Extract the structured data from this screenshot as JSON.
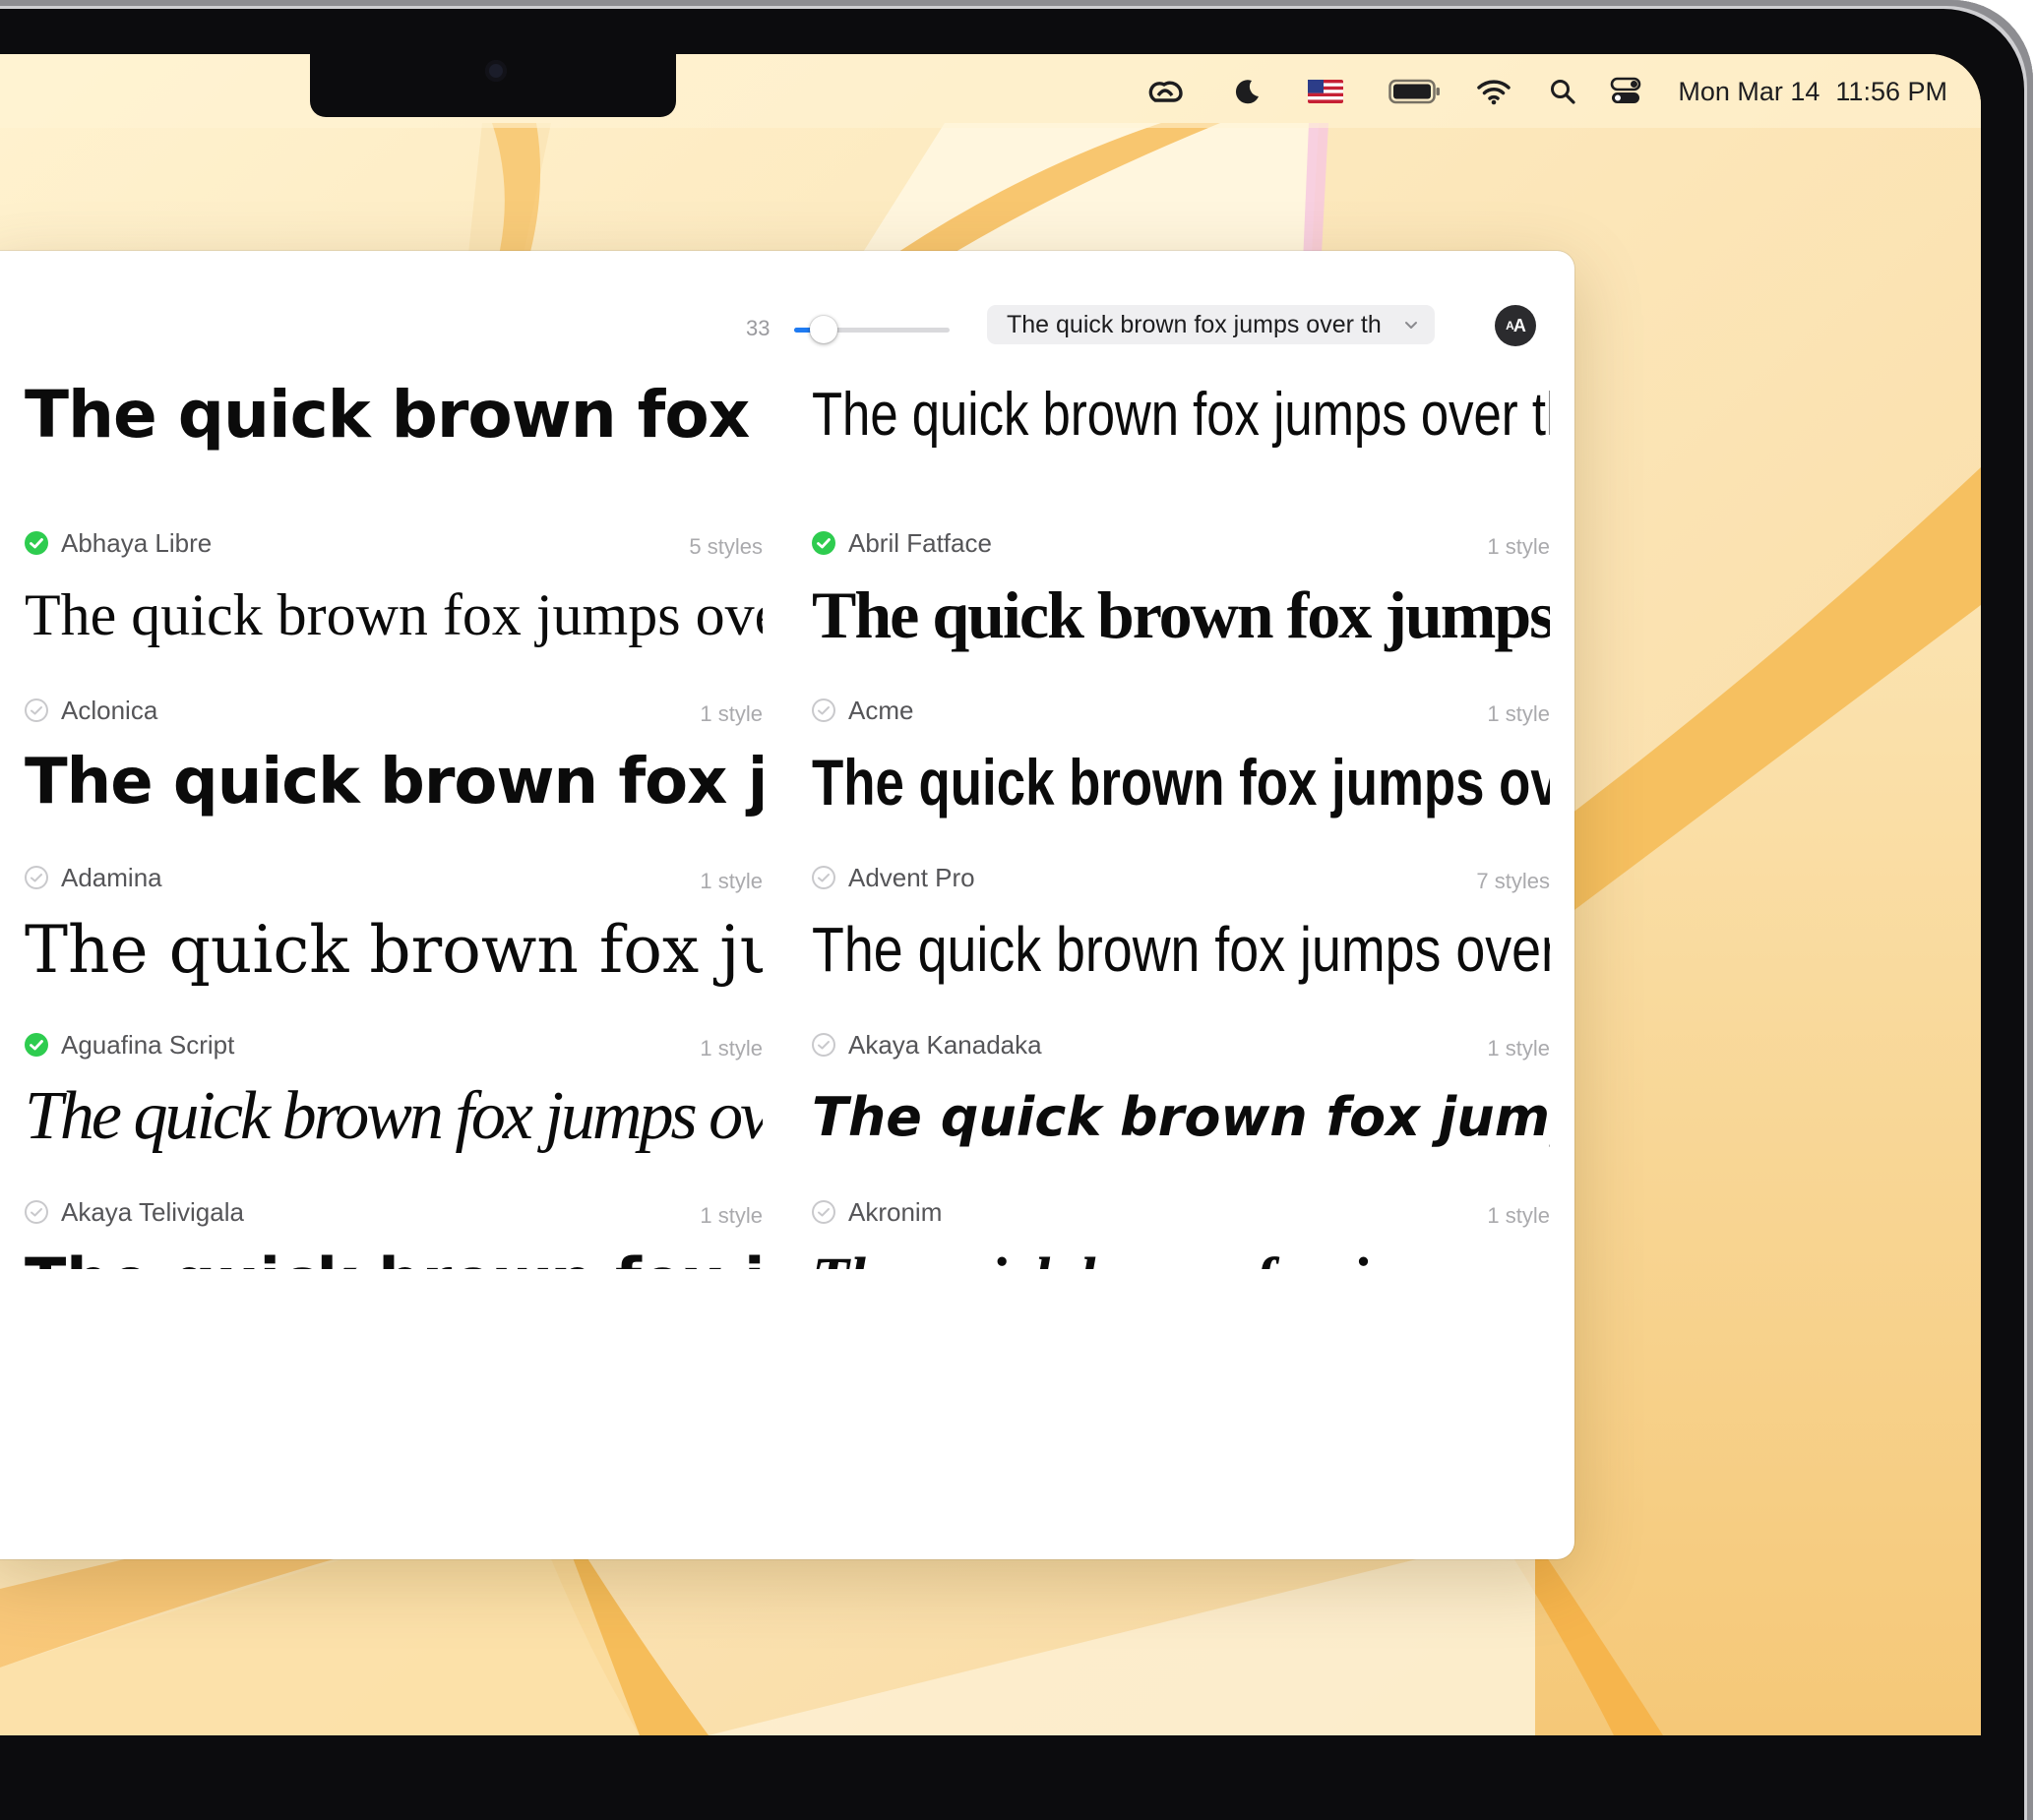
{
  "menubar": {
    "icons": [
      "creative-cloud-icon",
      "moon-icon",
      "us-flag-icon",
      "battery-icon",
      "wifi-icon",
      "search-icon",
      "control-center-icon"
    ],
    "date": "Mon Mar 14",
    "time": "11:56 PM"
  },
  "toolbar": {
    "size_value": "33",
    "size_fraction": 0.12,
    "sample_text": "The quick brown fox jumps over th",
    "aa_label_small": "A",
    "aa_label_big": "A",
    "accent_color": "#1f7bf2"
  },
  "sample_text": "The quick brown fox jumps over the lazy dog",
  "fonts": {
    "left": [
      {
        "name": "",
        "styles": "",
        "installed": null
      },
      {
        "name": "Abhaya Libre",
        "styles": "5 styles",
        "installed": true
      },
      {
        "name": "Aclonica",
        "styles": "1 style",
        "installed": false
      },
      {
        "name": "Adamina",
        "styles": "1 style",
        "installed": false
      },
      {
        "name": "Aguafina Script",
        "styles": "1 style",
        "installed": true
      },
      {
        "name": "Akaya Telivigala",
        "styles": "1 style",
        "installed": false
      }
    ],
    "right": [
      {
        "name": "",
        "styles": "",
        "installed": null
      },
      {
        "name": "Abril Fatface",
        "styles": "1 style",
        "installed": true
      },
      {
        "name": "Acme",
        "styles": "1 style",
        "installed": false
      },
      {
        "name": "Advent Pro",
        "styles": "7 styles",
        "installed": false
      },
      {
        "name": "Akaya Kanadaka",
        "styles": "1 style",
        "installed": false
      },
      {
        "name": "Akronim",
        "styles": "1 style",
        "installed": false
      }
    ]
  },
  "colors": {
    "installed_check": "#2ecc4f",
    "wallpaper": "#f7d79a"
  }
}
